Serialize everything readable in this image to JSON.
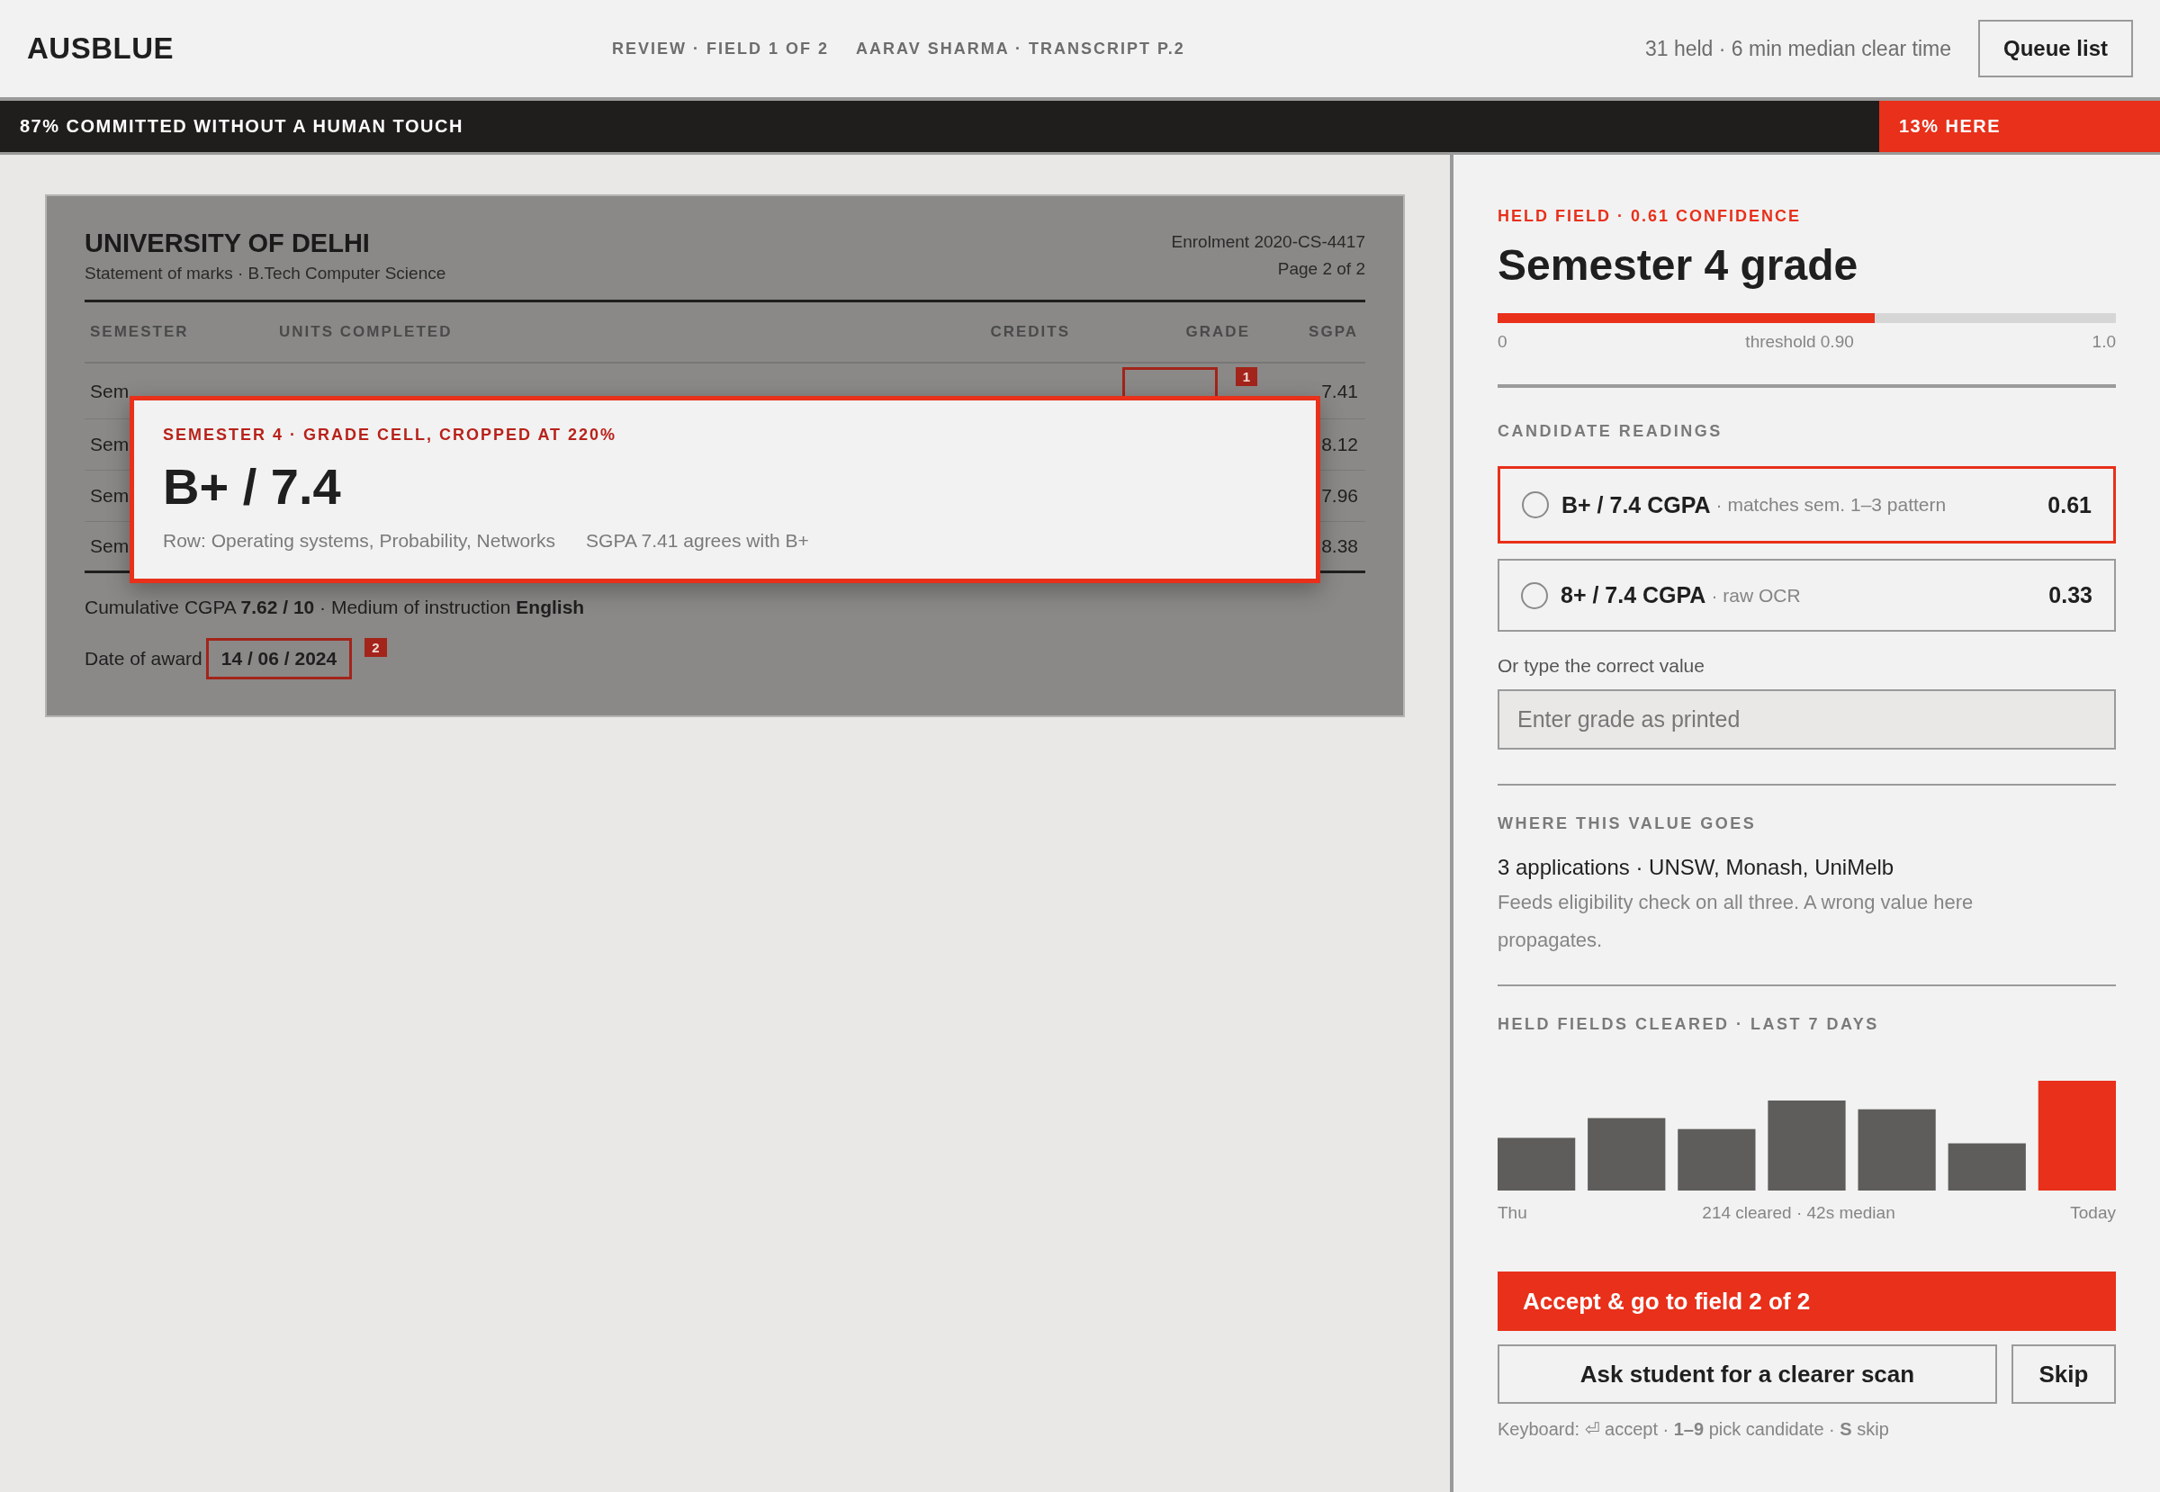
{
  "header": {
    "logo": "AUSBLUE",
    "crumbs": [
      "REVIEW · FIELD 1 OF 2",
      "AARAV SHARMA · TRANSCRIPT P.2"
    ],
    "stats": "31 held · 6 min median clear time",
    "queue_button": "Queue list"
  },
  "banner": {
    "left": "87% COMMITTED WITHOUT A HUMAN TOUCH",
    "right": "13% HERE",
    "level": 0.87
  },
  "document": {
    "title": "UNIVERSITY OF DELHI",
    "subtitle": "Statement of marks · B.Tech Computer Science",
    "enrolment": "Enrolment 2020-CS-4417",
    "page": "Page 2 of 2",
    "columns": [
      "SEMESTER",
      "UNITS COMPLETED",
      "CREDITS",
      "GRADE",
      "SGPA"
    ],
    "rows": [
      {
        "semester": "Sem",
        "sgpa": "7.41",
        "flag": "1"
      },
      {
        "semester": "Sem",
        "sgpa": "8.12"
      },
      {
        "semester": "Sem",
        "sgpa": "7.96"
      },
      {
        "semester": "Sem",
        "sgpa": "8.38"
      }
    ],
    "cumulative": "Cumulative CGPA **7.62 / 10** · Medium of instruction **English**",
    "award_label": "Date of award",
    "award_date": "14 / 06 / 2024",
    "award_flag": "2"
  },
  "zoom_popup": {
    "label": "SEMESTER 4 · GRADE CELL, CROPPED AT 220%",
    "value": "B+ / 7.4",
    "notes": [
      "Row: Operating systems, Probability, Networks",
      "SGPA 7.41 agrees with B+"
    ]
  },
  "field": {
    "eyebrow": "HELD FIELD · 0.61 CONFIDENCE",
    "title": "Semester 4 grade",
    "level": 0.61,
    "scale": [
      "0",
      "threshold 0.90",
      "1.0"
    ]
  },
  "candidates": {
    "heading": "CANDIDATE READINGS",
    "items": [
      {
        "value": "B+ / 7.4 CGPA",
        "note": "· matches sem. 1–3 pattern",
        "score": "0.61",
        "selected": false,
        "recommended": true
      },
      {
        "value": "8+ / 7.4 CGPA",
        "note": "· raw OCR",
        "score": "0.33",
        "selected": false,
        "recommended": false
      }
    ]
  },
  "manual": {
    "label": "Or type the correct value",
    "placeholder": "Enter grade as printed"
  },
  "destination": {
    "heading": "WHERE THIS VALUE GOES",
    "summary": "3 applications · UNSW, Monash, UniMelb",
    "note": "Feeds eligibility check on all three. A wrong value here propagates."
  },
  "cleared": {
    "heading": "HELD FIELDS CLEARED · LAST 7 DAYS",
    "labels": [
      "Thu",
      "214 cleared · 42s median",
      "Today"
    ]
  },
  "actions": {
    "primary": "Accept & go to field 2 of 2",
    "secondary": "Ask student for a clearer scan",
    "skip": "Skip",
    "hint": "Keyboard: ⏎ accept · **1–9** pick candidate · **S** skip"
  }
}
